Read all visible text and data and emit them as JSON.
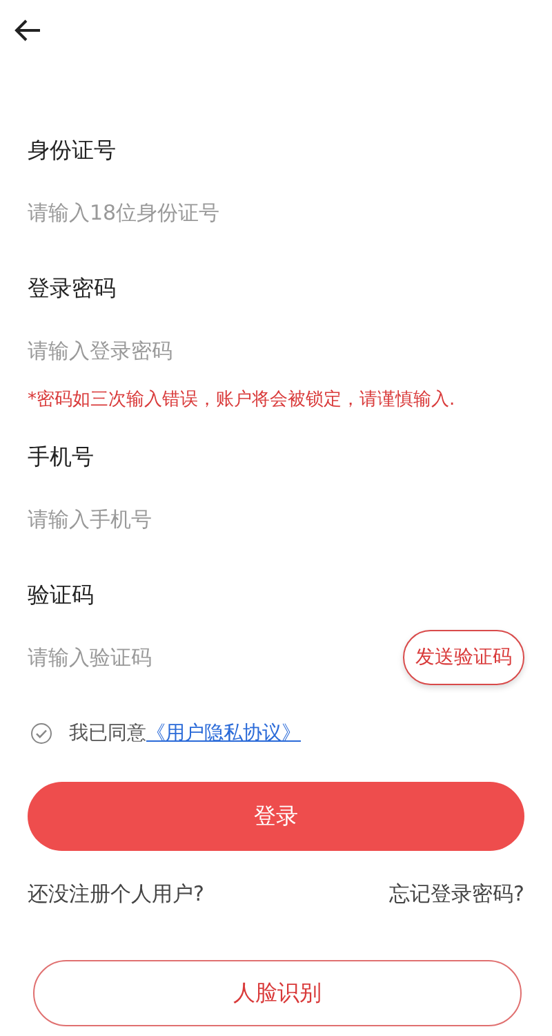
{
  "fields": [
    {
      "kind": "text",
      "label": "身份证号",
      "placeholder": "请输入18位身份证号"
    },
    {
      "kind": "password",
      "label": "登录密码",
      "placeholder": "请输入登录密码",
      "warning": "*密码如三次输入错误，账户将会被锁定，请谨慎输入."
    },
    {
      "kind": "text",
      "label": "手机号",
      "placeholder": "请输入手机号"
    },
    {
      "kind": "sms",
      "label": "验证码",
      "placeholder": "请输入验证码",
      "action": "发送验证码"
    }
  ],
  "agreement": {
    "checked": false,
    "text": "我已同意",
    "link": "《用户隐私协议》"
  },
  "login_button": "登录",
  "links": [
    "还没注册个人用户?",
    "忘记登录密码?"
  ],
  "face_button": "人脸识别"
}
